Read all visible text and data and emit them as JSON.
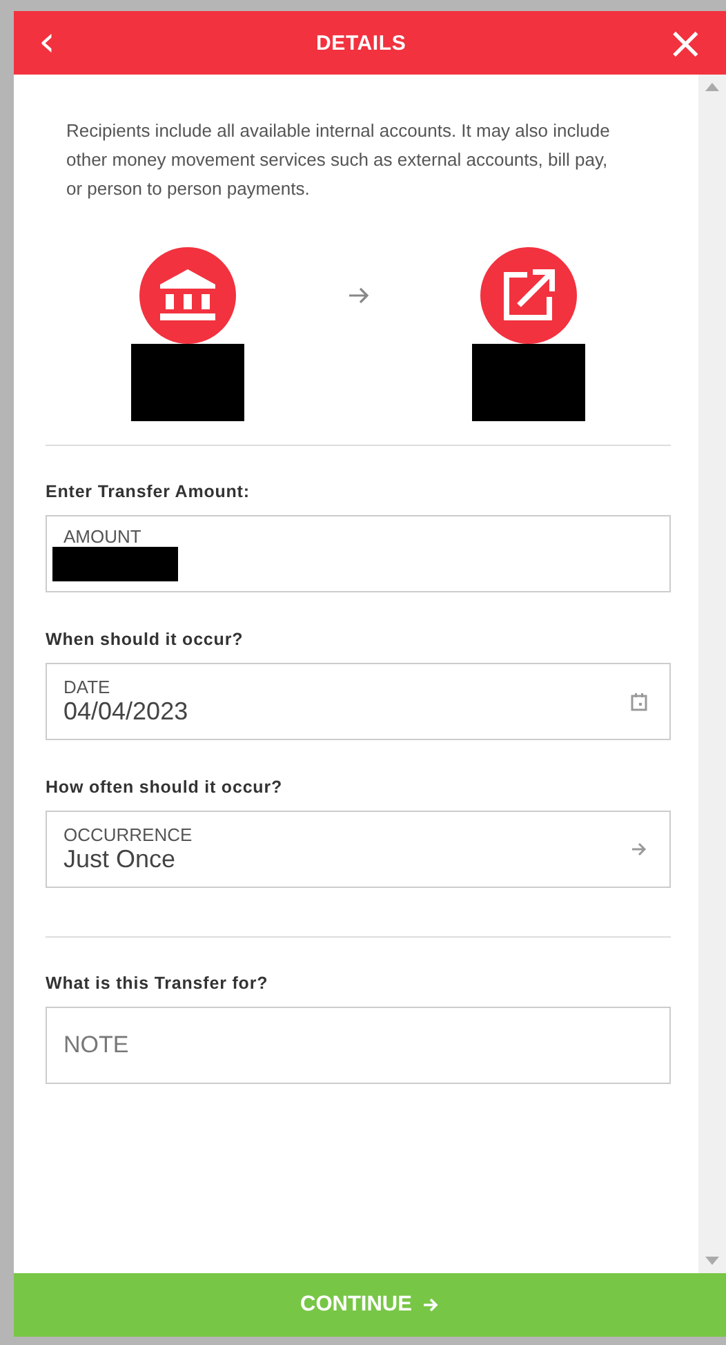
{
  "header": {
    "title": "DETAILS",
    "back": "‹",
    "close": "×"
  },
  "intro": "Recipients include all available internal accounts. It may also include other money movement services such as external accounts, bill pay, or person to person payments.",
  "transfer": [
    {
      "kind": "bank"
    },
    {
      "kind": "external"
    }
  ],
  "sections": [
    {
      "fields": [
        {
          "question": "Enter Transfer Amount:",
          "label": "AMOUNT",
          "kind": "redacted"
        },
        {
          "question": "When should it occur?",
          "label": "DATE",
          "value": "04/04/2023",
          "kind": "date"
        },
        {
          "question": "How often should it occur?",
          "label": "OCCURRENCE",
          "value": "Just Once",
          "kind": "select"
        }
      ]
    },
    {
      "fields": [
        {
          "question": "What is this Transfer for?",
          "placeholder": "NOTE",
          "kind": "note"
        }
      ]
    }
  ],
  "continue_button": "CONTINUE"
}
